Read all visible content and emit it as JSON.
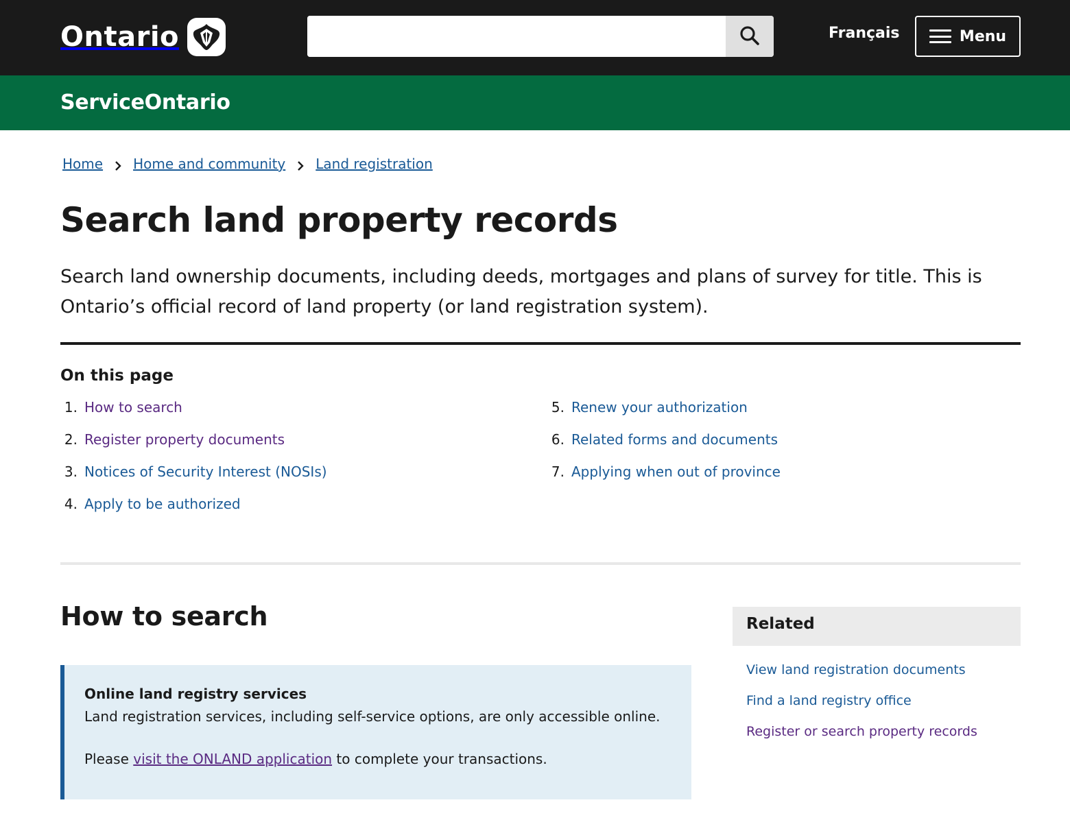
{
  "header": {
    "logo_text": "Ontario",
    "search_placeholder": "",
    "language_link": "Français",
    "menu_label": "Menu"
  },
  "service_bar": {
    "title": "ServiceOntario"
  },
  "breadcrumb": [
    "Home",
    "Home and community",
    "Land registration"
  ],
  "page": {
    "title": "Search land property records",
    "lead": "Search land ownership documents, including deeds, mortgages and plans of survey for title. This is Ontario’s official record of land property (or land registration system)."
  },
  "on_this_page": {
    "heading": "On this page",
    "items": [
      {
        "num": "1.",
        "label": "How to search",
        "visited": true
      },
      {
        "num": "2.",
        "label": "Register property documents",
        "visited": true
      },
      {
        "num": "3.",
        "label": "Notices of Security Interest (NOSIs)",
        "visited": false
      },
      {
        "num": "4.",
        "label": "Apply to be authorized",
        "visited": false
      },
      {
        "num": "5.",
        "label": "Renew your authorization",
        "visited": false
      },
      {
        "num": "6.",
        "label": "Related forms and documents",
        "visited": false
      },
      {
        "num": "7.",
        "label": "Applying when out of province",
        "visited": false
      }
    ]
  },
  "how_to_search": {
    "title": "How to search",
    "callout": {
      "title": "Online land registry services",
      "text": "Land registration services, including self-service options, are only accessible online.",
      "text2_prefix": "Please ",
      "text2_link": "visit the ONLAND application",
      "text2_suffix": " to complete your transactions."
    }
  },
  "related": {
    "heading": "Related",
    "links": [
      {
        "label": "View land registration documents",
        "visited": false
      },
      {
        "label": "Find a land registry office",
        "visited": false
      },
      {
        "label": "Register or search property records",
        "visited": true
      }
    ]
  },
  "icons": {
    "logo": "ontario-trillium-icon",
    "search": "search-icon",
    "menu": "hamburger-menu-icon",
    "breadcrumb_separator": "chevron-right-icon"
  },
  "colors": {
    "header_bg": "#1a1a1a",
    "service_bar_bg": "#046b40",
    "link": "#1a5a96",
    "visited_link": "#5a2a82",
    "callout_bg": "#e2eef5",
    "callout_border": "#1a5a96"
  }
}
